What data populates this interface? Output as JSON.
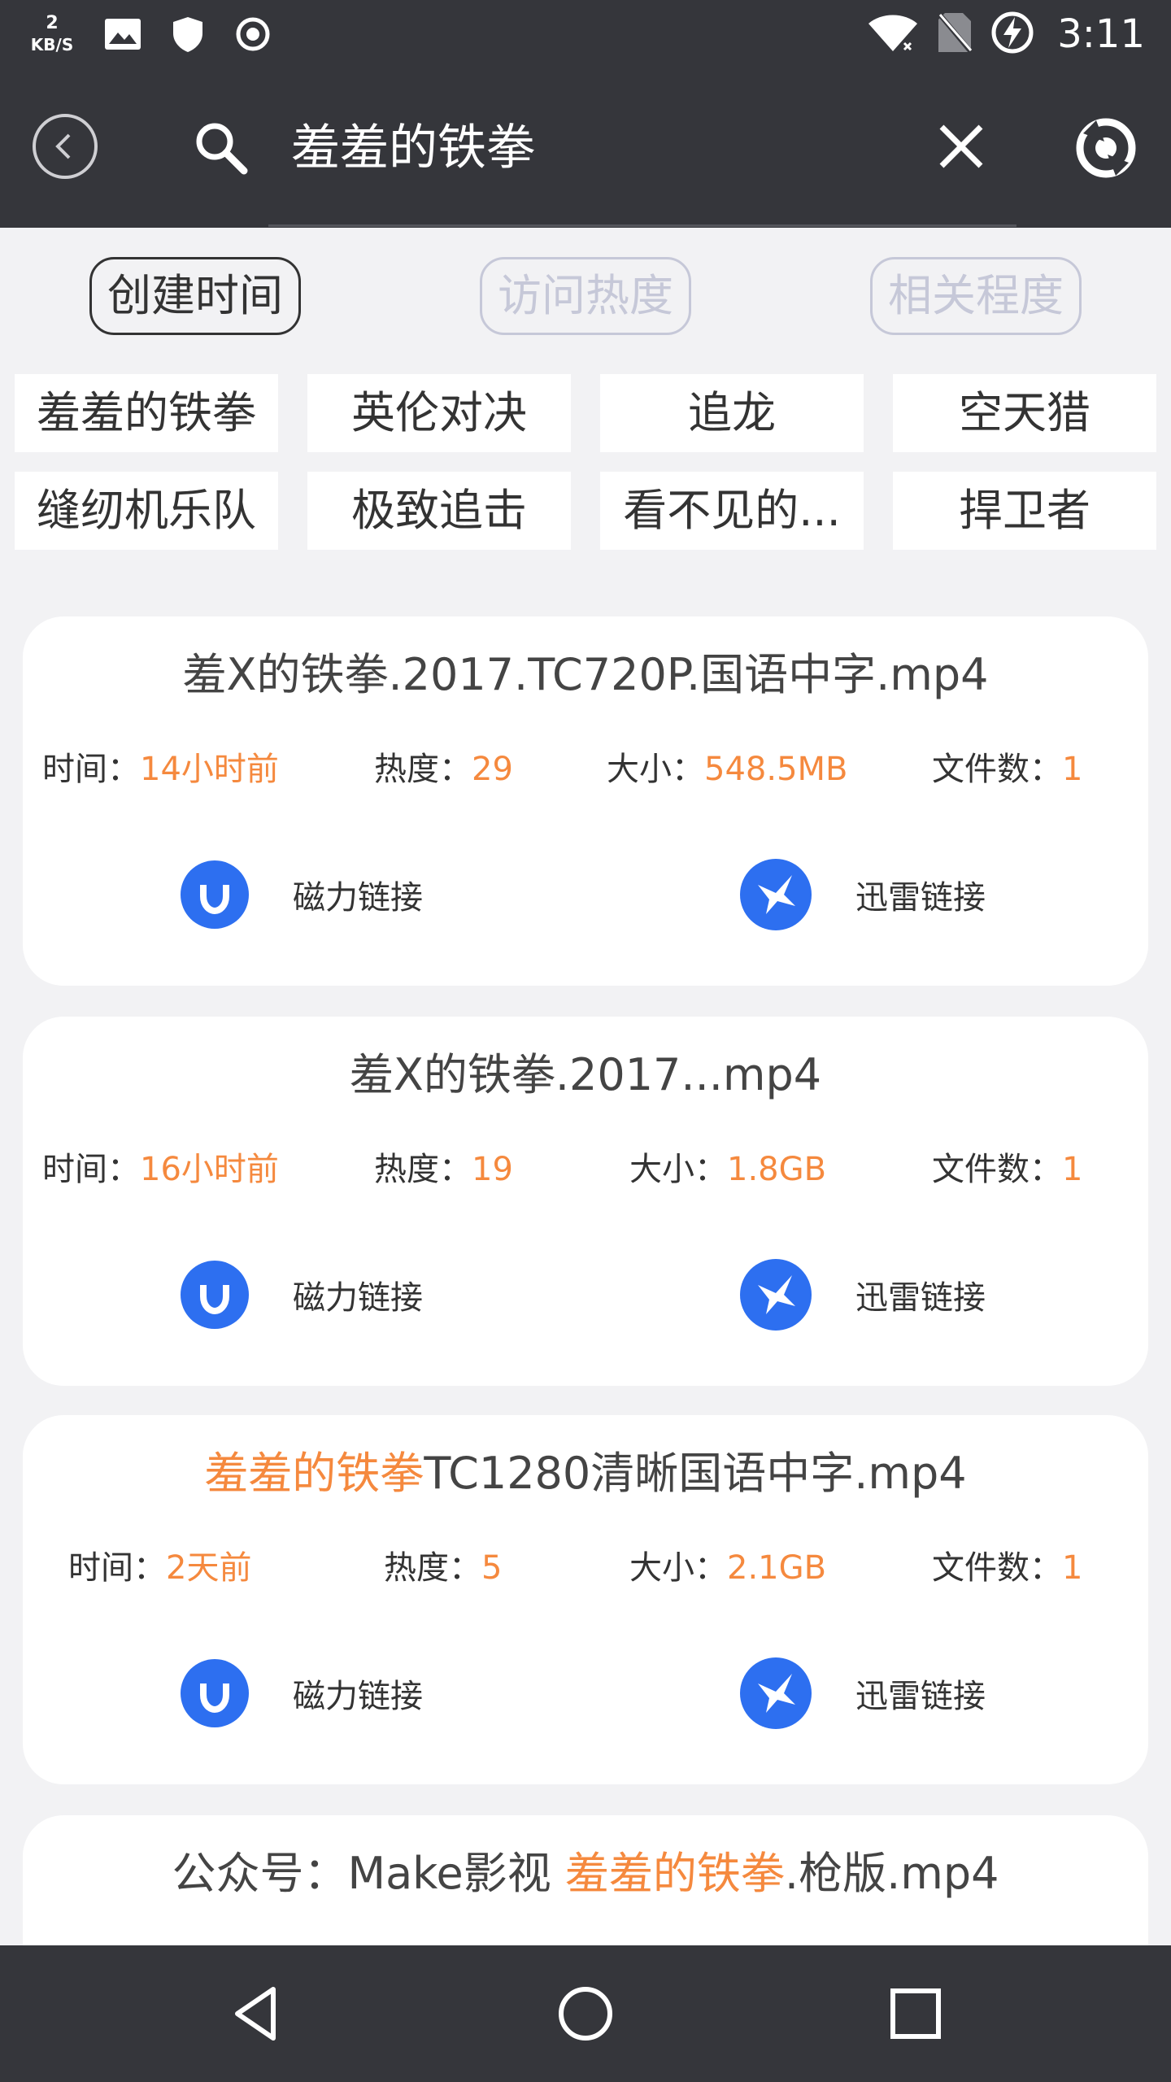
{
  "status_bar": {
    "speed_value": "2",
    "speed_unit": "KB/S",
    "time": "3:11",
    "icons": [
      "image-icon",
      "shield-icon",
      "record-icon",
      "wifi-icon",
      "no-sim-icon",
      "battery-charging-icon"
    ]
  },
  "header": {
    "search_query": "羞羞的铁拳",
    "icons": [
      "back-icon",
      "search-icon",
      "close-icon",
      "refresh-icon"
    ]
  },
  "sort_options": [
    "创建时间",
    "访问热度",
    "相关程度"
  ],
  "sort_active": "创建时间",
  "keyword_tags": [
    "羞羞的铁拳",
    "英伦对决",
    "追龙",
    "空天猎",
    "缝纫机乐队",
    "极致追击",
    "看不见的...",
    "捍卫者"
  ],
  "results": [
    {
      "title": "羞X的铁拳.2017.TC720P.国语中字.mp4",
      "time_label": "时间：",
      "time_value": "14小时前",
      "heat_label": "热度：",
      "heat_value": "29",
      "size_label": "大小：",
      "size_value": "548.5MB",
      "files_label": "文件数：",
      "files_value": "1",
      "magnet_label": "磁力链接",
      "thunder_label": "迅雷链接"
    },
    {
      "title": "羞X的铁拳.2017...mp4",
      "time_label": "时间：",
      "time_value": "16小时前",
      "heat_label": "热度：",
      "heat_value": "19",
      "size_label": "大小：",
      "size_value": "1.8GB",
      "files_label": "文件数：",
      "files_value": "1",
      "magnet_label": "磁力链接",
      "thunder_label": "迅雷链接"
    },
    {
      "title_highlight": "羞羞的铁拳",
      "title_rest": "TC1280清晰国语中字.mp4",
      "time_label": "时间：",
      "time_value": "2天前",
      "heat_label": "热度：",
      "heat_value": "5",
      "size_label": "大小：",
      "size_value": "2.1GB",
      "files_label": "文件数：",
      "files_value": "1",
      "magnet_label": "磁力链接",
      "thunder_label": "迅雷链接"
    },
    {
      "title_prefix": "公众号：Make影视 ",
      "title_highlight": "羞羞的铁拳",
      "title_rest": ".枪版.mp4"
    }
  ],
  "nav_bar": {
    "icons": [
      "nav-back-icon",
      "nav-home-icon",
      "nav-recents-icon"
    ]
  },
  "colors": {
    "bar_bg": "#35363b",
    "highlight": "#f5893e",
    "link_icon": "#2d6ff0",
    "page_bg": "#f2f2f4"
  }
}
